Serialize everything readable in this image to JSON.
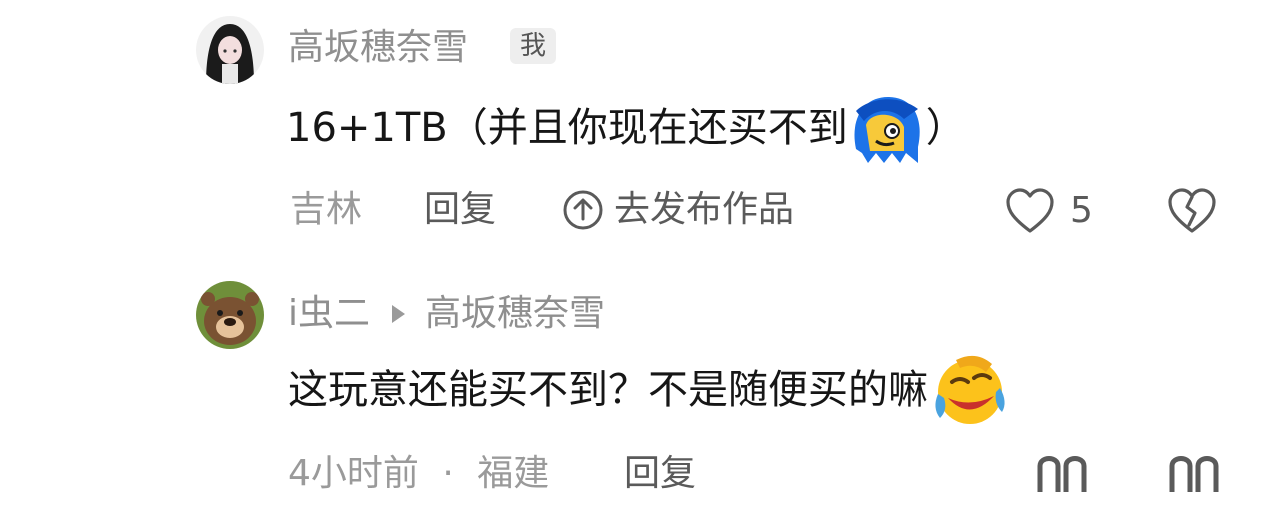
{
  "comments": [
    {
      "username": "高坂穗奈雪",
      "badge": "我",
      "text": "16+1TB（并且你现在还买不到",
      "text_suffix": "）",
      "location": "吉林",
      "reply_label": "回复",
      "publish_label": "去发布作品",
      "like_count": "5"
    },
    {
      "username": "i虫二",
      "reply_to": "高坂穗奈雪",
      "text": "这玩意还能买不到？不是随便买的嘛",
      "time": "4小时前",
      "separator": "·",
      "location": "福建",
      "reply_label": "回复"
    }
  ],
  "colors": {
    "text": "#161616",
    "muted": "#8f8f8f",
    "action": "#5a5a5a"
  }
}
